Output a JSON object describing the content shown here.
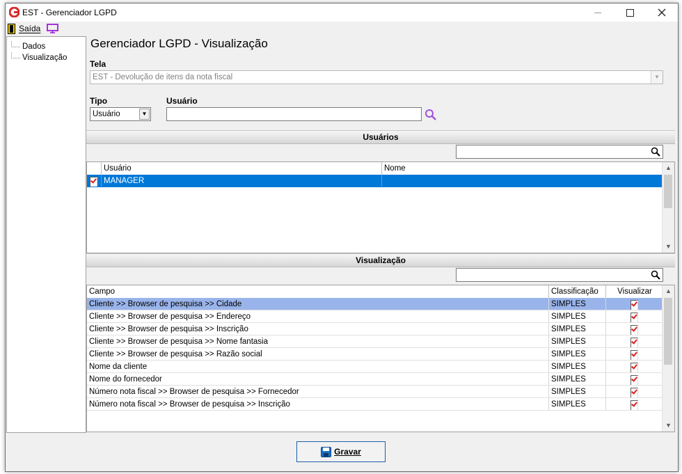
{
  "window": {
    "title": "EST - Gerenciador LGPD"
  },
  "menu": {
    "exit_label": "Saída"
  },
  "tree": {
    "items": [
      "Dados",
      "Visualização"
    ]
  },
  "page": {
    "heading": "Gerenciador LGPD - Visualização"
  },
  "form": {
    "tela_label": "Tela",
    "tela_value": "EST - Devolução de itens da nota fiscal",
    "tipo_label": "Tipo",
    "tipo_value": "Usuário",
    "usuario_label": "Usuário",
    "usuario_value": ""
  },
  "users_section": {
    "title": "Usuários",
    "filter_value": "",
    "columns": [
      "Usuário",
      "Nome"
    ],
    "rows": [
      {
        "checked": true,
        "usuario": "MANAGER",
        "nome": ""
      }
    ]
  },
  "view_section": {
    "title": "Visualização",
    "filter_value": "",
    "columns": [
      "Campo",
      "Classificação",
      "Visualizar"
    ],
    "rows": [
      {
        "campo": "Cliente >> Browser de pesquisa >> Cidade",
        "classificacao": "SIMPLES",
        "visualizar": true
      },
      {
        "campo": "Cliente >> Browser de pesquisa >> Endereço",
        "classificacao": "SIMPLES",
        "visualizar": true
      },
      {
        "campo": "Cliente >> Browser de pesquisa >> Inscrição",
        "classificacao": "SIMPLES",
        "visualizar": true
      },
      {
        "campo": "Cliente >> Browser de pesquisa >> Nome fantasia",
        "classificacao": "SIMPLES",
        "visualizar": true
      },
      {
        "campo": "Cliente >> Browser de pesquisa >> Razão social",
        "classificacao": "SIMPLES",
        "visualizar": true
      },
      {
        "campo": "Nome da cliente",
        "classificacao": "SIMPLES",
        "visualizar": true
      },
      {
        "campo": "Nome do fornecedor",
        "classificacao": "SIMPLES",
        "visualizar": true
      },
      {
        "campo": "Número nota fiscal >> Browser de pesquisa >> Fornecedor",
        "classificacao": "SIMPLES",
        "visualizar": true
      },
      {
        "campo": "Número nota fiscal >> Browser de pesquisa >> Inscrição",
        "classificacao": "SIMPLES",
        "visualizar": true
      }
    ]
  },
  "buttons": {
    "save_label": "Gravar"
  },
  "colors": {
    "selection": "#0078d7",
    "row_highlight": "#99b4ea",
    "accent": "#9b3fd6",
    "check": "#d42020"
  },
  "icons": [
    "app-logo-icon",
    "minimize-icon",
    "maximize-icon",
    "close-icon",
    "exit-door-icon",
    "monitor-icon",
    "search-icon",
    "save-disk-icon"
  ]
}
